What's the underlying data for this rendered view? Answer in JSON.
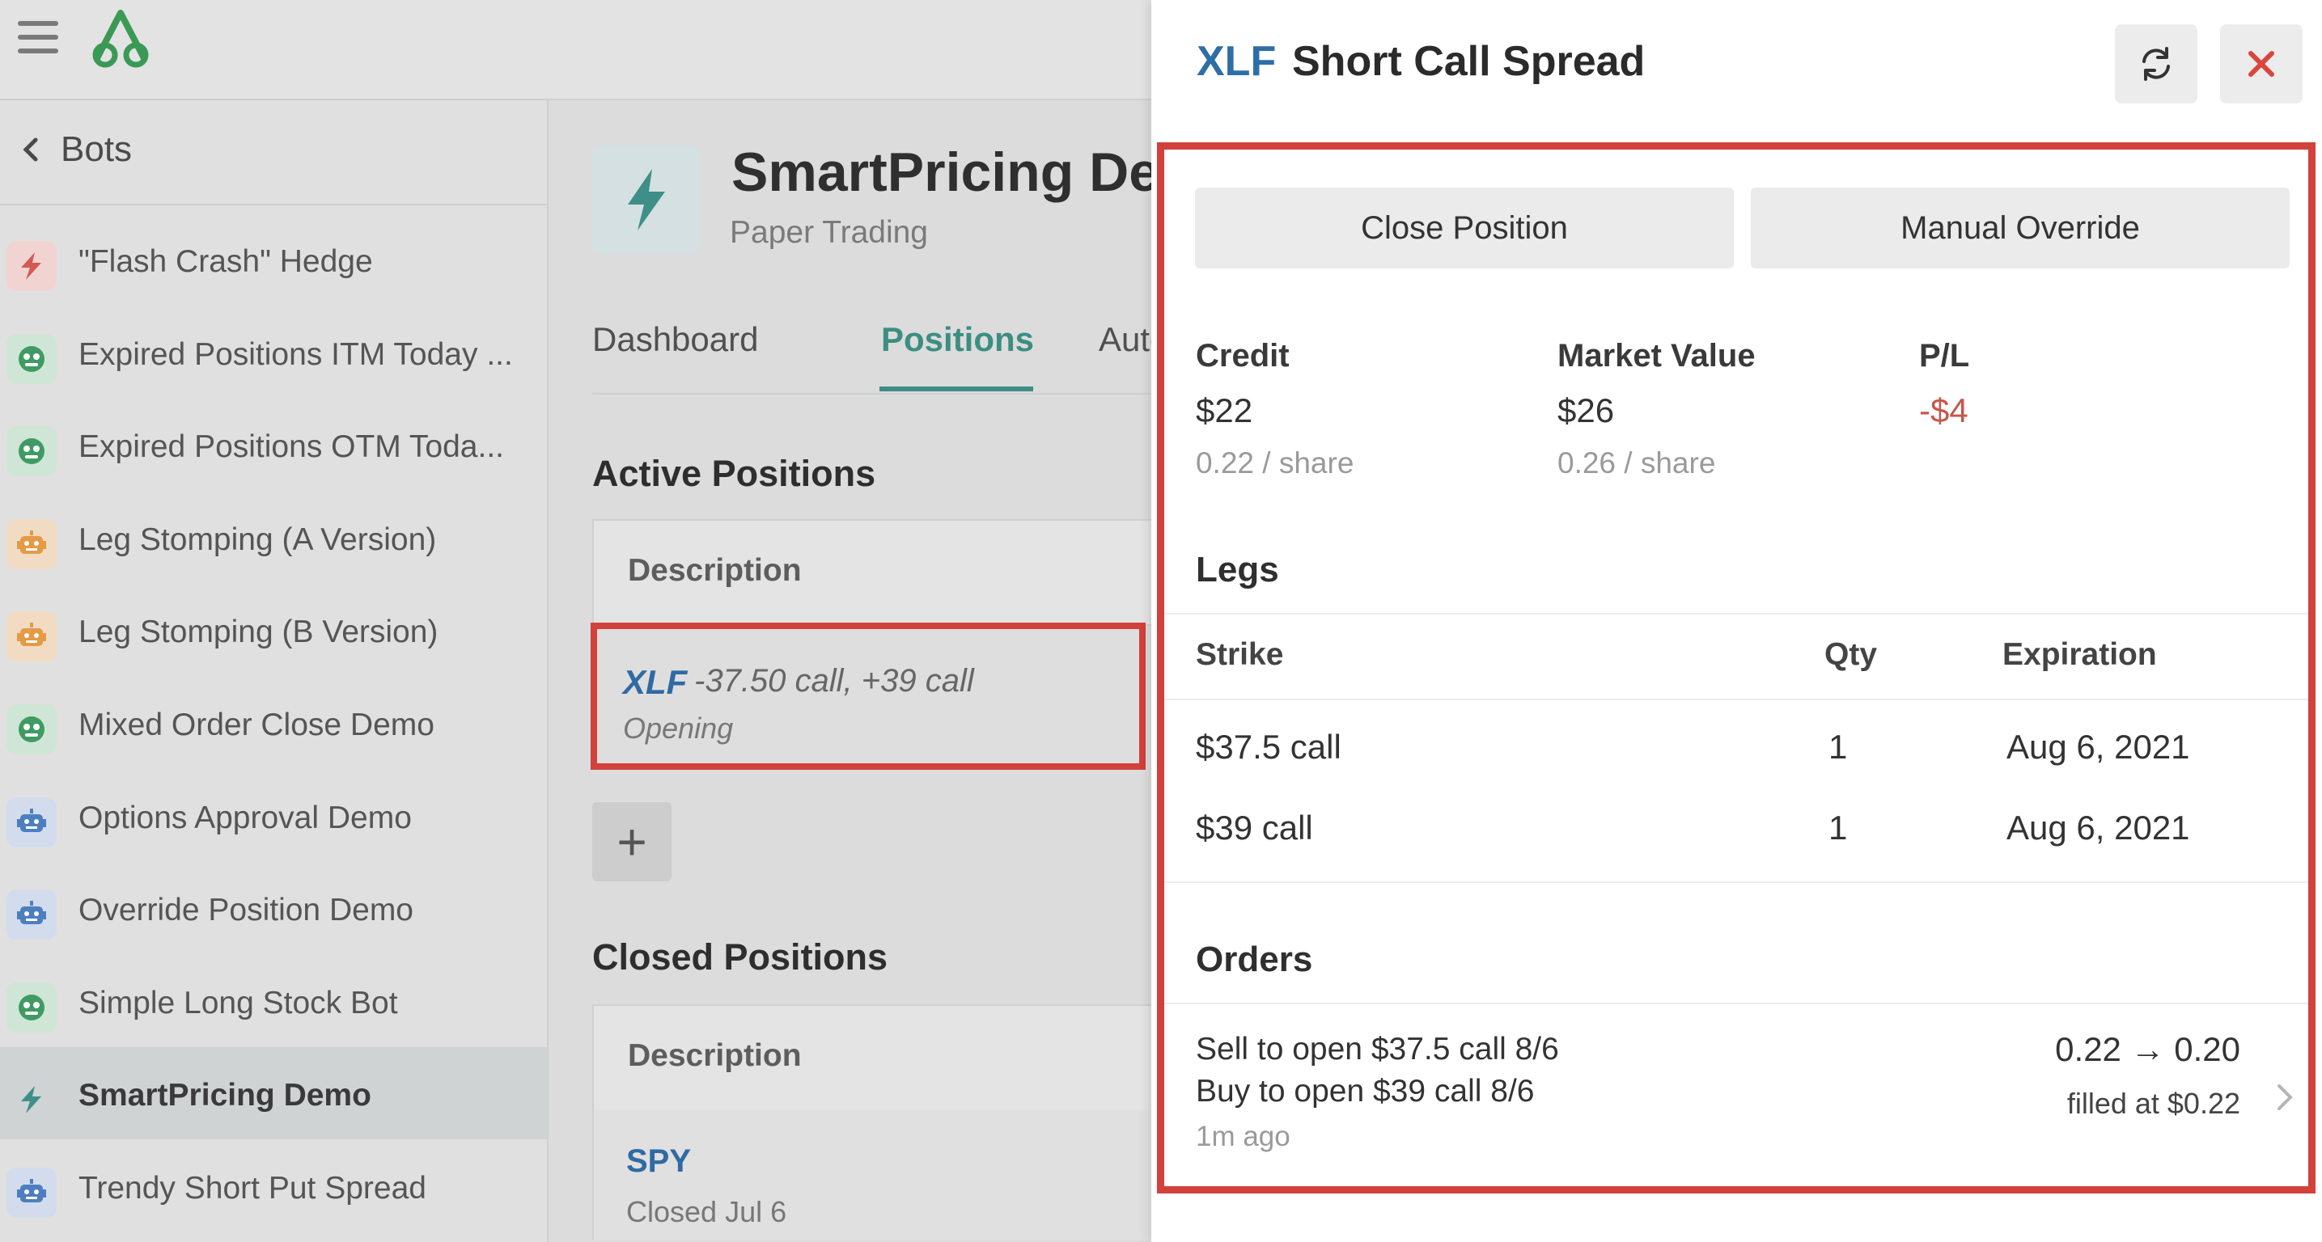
{
  "sidebar": {
    "back_label": "Bots",
    "items": [
      {
        "label": "\"Flash Crash\" Hedge",
        "icon": "lightning-bolt-icon",
        "icon_color": "#d35a52",
        "icon_bg": "#f1d4d1"
      },
      {
        "label": "Expired Positions ITM Today ...",
        "icon": "robot-face-icon",
        "icon_color": "#3f9b63",
        "icon_bg": "#cfe6d6"
      },
      {
        "label": "Expired Positions OTM Toda...",
        "icon": "robot-face-icon",
        "icon_color": "#3f9b63",
        "icon_bg": "#cfe6d6"
      },
      {
        "label": "Leg Stomping (A Version)",
        "icon": "robot-icon",
        "icon_color": "#e59a45",
        "icon_bg": "#f1dcc3"
      },
      {
        "label": "Leg Stomping (B Version)",
        "icon": "robot-icon",
        "icon_color": "#e59a45",
        "icon_bg": "#f1dcc3"
      },
      {
        "label": "Mixed Order Close Demo",
        "icon": "robot-face-icon",
        "icon_color": "#3f9b63",
        "icon_bg": "#cfe6d6"
      },
      {
        "label": "Options Approval Demo",
        "icon": "robot-icon",
        "icon_color": "#4d7fc0",
        "icon_bg": "#d3dced"
      },
      {
        "label": "Override Position Demo",
        "icon": "robot-icon",
        "icon_color": "#4d7fc0",
        "icon_bg": "#d3dced"
      },
      {
        "label": "Simple Long Stock Bot",
        "icon": "robot-face-icon",
        "icon_color": "#3f9b63",
        "icon_bg": "#cfe6d6"
      },
      {
        "label": "SmartPricing Demo",
        "icon": "lightning-bolt-icon",
        "icon_color": "#3e8f88",
        "icon_bg": "#cfd3d4",
        "active": true
      },
      {
        "label": "Trendy Short Put Spread",
        "icon": "robot-icon",
        "icon_color": "#4d7fc0",
        "icon_bg": "#d3dced"
      }
    ]
  },
  "main": {
    "title": "SmartPricing De",
    "subtitle": "Paper Trading",
    "tabs": [
      "Dashboard",
      "Positions",
      "Auton"
    ],
    "active_section": "Active Positions",
    "closed_section": "Closed Positions",
    "column_header": "Description",
    "active_position": {
      "symbol": "XLF",
      "legs": "-37.50 call, +39 call",
      "status": "Opening"
    },
    "add_label": "+",
    "closed_position": {
      "symbol": "SPY",
      "status": "Closed Jul 6"
    }
  },
  "panel": {
    "symbol": "XLF",
    "title": "Short Call Spread",
    "buttons": {
      "close": "Close Position",
      "override": "Manual Override"
    },
    "metrics": [
      {
        "label": "Credit",
        "value": "$22",
        "sub": "0.22 / share"
      },
      {
        "label": "Market Value",
        "value": "$26",
        "sub": "0.26 / share"
      },
      {
        "label": "P/L",
        "value": "-$4",
        "sub": ""
      }
    ],
    "legs_title": "Legs",
    "legs_headers": {
      "strike": "Strike",
      "qty": "Qty",
      "expiration": "Expiration"
    },
    "legs": [
      {
        "strike": "$37.5 call",
        "qty": "1",
        "expiration": "Aug 6, 2021"
      },
      {
        "strike": "$39 call",
        "qty": "1",
        "expiration": "Aug 6, 2021"
      }
    ],
    "orders_title": "Orders",
    "order": {
      "line1": "Sell to open $37.5 call 8/6",
      "line2": "Buy to open $39 call 8/6",
      "time": "1m ago",
      "price": "0.22 → 0.20",
      "filled": "filled at $0.22"
    }
  },
  "colors": {
    "accent": "#3c8e82",
    "link": "#2e6ea8",
    "negative": "#c6574b",
    "highlight": "#d2413a",
    "close": "#d9463c"
  }
}
